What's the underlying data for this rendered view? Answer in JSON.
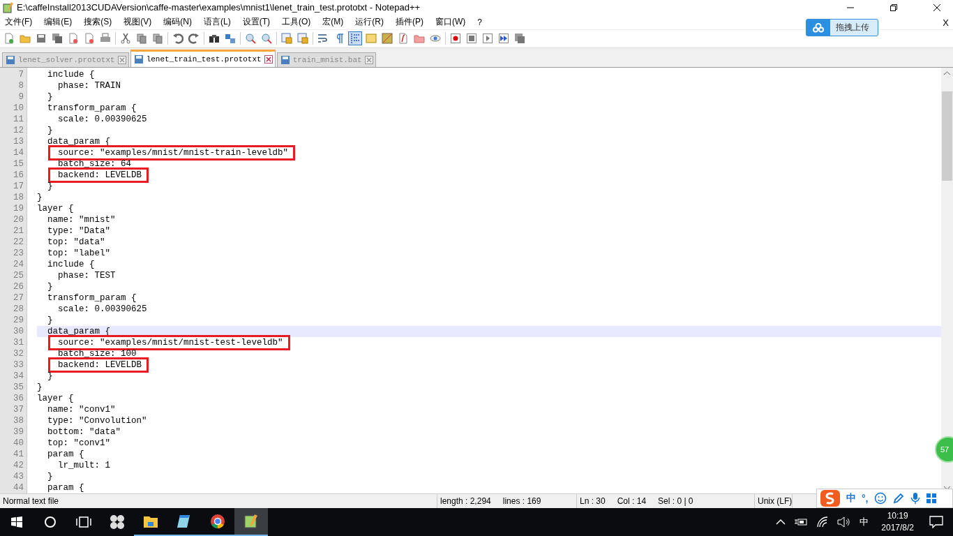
{
  "window": {
    "title": "E:\\caffeInstall2013CUDAVersion\\caffe-master\\examples\\mnist1\\lenet_train_test.prototxt - Notepad++"
  },
  "menu": [
    "文件(F)",
    "编辑(E)",
    "搜索(S)",
    "视图(V)",
    "编码(N)",
    "语言(L)",
    "设置(T)",
    "工具(O)",
    "宏(M)",
    "运行(R)",
    "插件(P)",
    "窗口(W)",
    "?"
  ],
  "upload_button": {
    "label": "拖拽上传"
  },
  "upload_close": "X",
  "toolbar": [
    {
      "kind": "new",
      "on": false
    },
    {
      "kind": "open",
      "on": false
    },
    {
      "kind": "save",
      "on": false
    },
    {
      "kind": "save-all",
      "on": false
    },
    {
      "kind": "close",
      "on": false
    },
    {
      "kind": "close-all",
      "on": false
    },
    {
      "kind": "print",
      "on": false
    },
    {
      "kind": "separator"
    },
    {
      "kind": "cut",
      "on": false
    },
    {
      "kind": "copy",
      "on": false
    },
    {
      "kind": "paste",
      "on": false
    },
    {
      "kind": "separator"
    },
    {
      "kind": "undo",
      "on": false
    },
    {
      "kind": "redo",
      "on": false
    },
    {
      "kind": "separator"
    },
    {
      "kind": "find",
      "on": false
    },
    {
      "kind": "replace",
      "on": false
    },
    {
      "kind": "separator"
    },
    {
      "kind": "zoom-in",
      "on": false
    },
    {
      "kind": "zoom-out",
      "on": false
    },
    {
      "kind": "separator"
    },
    {
      "kind": "sync-vertical",
      "on": false
    },
    {
      "kind": "sync-horizontal",
      "on": false
    },
    {
      "kind": "separator"
    },
    {
      "kind": "wrap",
      "on": false
    },
    {
      "kind": "pilcrow",
      "on": false
    },
    {
      "kind": "indent-guide",
      "on": true
    },
    {
      "kind": "panel",
      "on": false
    },
    {
      "kind": "map",
      "on": false
    },
    {
      "kind": "function",
      "on": false
    },
    {
      "kind": "folder",
      "on": false
    },
    {
      "kind": "eye",
      "on": false
    },
    {
      "kind": "separator"
    },
    {
      "kind": "record",
      "on": false
    },
    {
      "kind": "stop",
      "on": false
    },
    {
      "kind": "play",
      "on": false
    },
    {
      "kind": "fast-forward",
      "on": false
    },
    {
      "kind": "save-macro",
      "on": false
    }
  ],
  "tabs": [
    {
      "label": "lenet_solver.prototxt",
      "selected": false
    },
    {
      "label": "lenet_train_test.prototxt",
      "selected": true
    },
    {
      "label": "train_mnist.bat",
      "selected": false
    }
  ],
  "editor": {
    "lines": [
      {
        "number": "7",
        "text": "  include {",
        "current": false,
        "marked": false
      },
      {
        "number": "8",
        "text": "    phase: TRAIN",
        "current": false,
        "marked": false
      },
      {
        "number": "9",
        "text": "  }",
        "current": false,
        "marked": false
      },
      {
        "number": "10",
        "text": "  transform_param {",
        "current": false,
        "marked": false
      },
      {
        "number": "11",
        "text": "    scale: 0.00390625",
        "current": false,
        "marked": false
      },
      {
        "number": "12",
        "text": "  }",
        "current": false,
        "marked": false
      },
      {
        "number": "13",
        "text": "  data_param {",
        "current": false,
        "marked": false
      },
      {
        "number": "14",
        "text": "    source: \"examples/mnist/mnist-train-leveldb\"",
        "current": false,
        "marked": true
      },
      {
        "number": "15",
        "text": "    batch_size: 64",
        "current": false,
        "marked": false
      },
      {
        "number": "16",
        "text": "    backend: LEVELDB",
        "current": false,
        "marked": true
      },
      {
        "number": "17",
        "text": "  }",
        "current": false,
        "marked": false
      },
      {
        "number": "18",
        "text": "}",
        "current": false,
        "marked": false
      },
      {
        "number": "19",
        "text": "layer {",
        "current": false,
        "marked": false
      },
      {
        "number": "20",
        "text": "  name: \"mnist\"",
        "current": false,
        "marked": false
      },
      {
        "number": "21",
        "text": "  type: \"Data\"",
        "current": false,
        "marked": false
      },
      {
        "number": "22",
        "text": "  top: \"data\"",
        "current": false,
        "marked": false
      },
      {
        "number": "23",
        "text": "  top: \"label\"",
        "current": false,
        "marked": false
      },
      {
        "number": "24",
        "text": "  include {",
        "current": false,
        "marked": false
      },
      {
        "number": "25",
        "text": "    phase: TEST",
        "current": false,
        "marked": false
      },
      {
        "number": "26",
        "text": "  }",
        "current": false,
        "marked": false
      },
      {
        "number": "27",
        "text": "  transform_param {",
        "current": false,
        "marked": false
      },
      {
        "number": "28",
        "text": "    scale: 0.00390625",
        "current": false,
        "marked": false
      },
      {
        "number": "29",
        "text": "  }",
        "current": false,
        "marked": false
      },
      {
        "number": "30",
        "text": "  data_param {",
        "current": true,
        "marked": false
      },
      {
        "number": "31",
        "text": "    source: \"examples/mnist/mnist-test-leveldb\"",
        "current": false,
        "marked": true
      },
      {
        "number": "32",
        "text": "    batch_size: 100",
        "current": false,
        "marked": false
      },
      {
        "number": "33",
        "text": "    backend: LEVELDB",
        "current": false,
        "marked": true
      },
      {
        "number": "34",
        "text": "  }",
        "current": false,
        "marked": false
      },
      {
        "number": "35",
        "text": "}",
        "current": false,
        "marked": false
      },
      {
        "number": "36",
        "text": "layer {",
        "current": false,
        "marked": false
      },
      {
        "number": "37",
        "text": "  name: \"conv1\"",
        "current": false,
        "marked": false
      },
      {
        "number": "38",
        "text": "  type: \"Convolution\"",
        "current": false,
        "marked": false
      },
      {
        "number": "39",
        "text": "  bottom: \"data\"",
        "current": false,
        "marked": false
      },
      {
        "number": "40",
        "text": "  top: \"conv1\"",
        "current": false,
        "marked": false
      },
      {
        "number": "41",
        "text": "  param {",
        "current": false,
        "marked": false
      },
      {
        "number": "42",
        "text": "    lr_mult: 1",
        "current": false,
        "marked": false
      },
      {
        "number": "43",
        "text": "  }",
        "current": false,
        "marked": false
      },
      {
        "number": "44",
        "text": "  param {",
        "current": false,
        "marked": false
      }
    ]
  },
  "floating_badge": "57",
  "status_bar": [
    "Normal text file",
    "length : 2,294",
    "lines : 169",
    "Ln : 30",
    "Col : 14",
    "Sel : 0 | 0",
    "Unix (LF)"
  ],
  "ime_bar": {
    "mode": "中",
    "punctuation": "°,"
  },
  "taskbar": {
    "apps": [
      {
        "kind": "fan",
        "running": false,
        "active": false
      },
      {
        "kind": "explorer",
        "running": true,
        "active": false
      },
      {
        "kind": "notepad",
        "running": true,
        "active": false
      },
      {
        "kind": "chrome",
        "running": true,
        "active": false
      },
      {
        "kind": "notepadpp",
        "running": true,
        "active": true
      }
    ],
    "ime": "中",
    "time": "10:19",
    "date": "2017/8/2"
  }
}
